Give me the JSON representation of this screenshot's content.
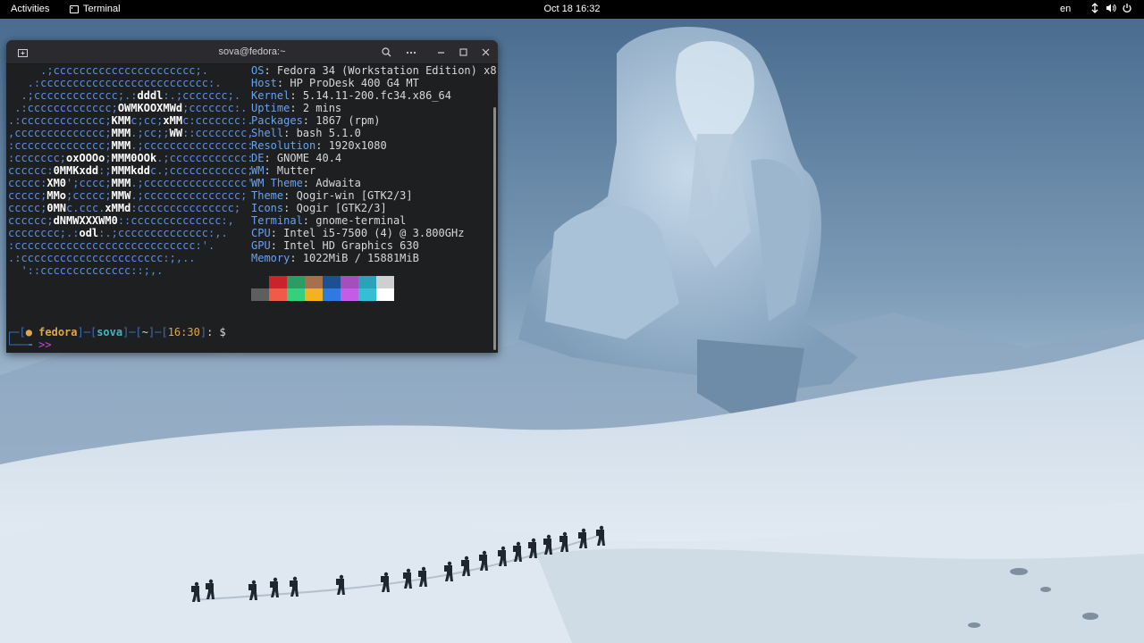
{
  "topbar": {
    "activities": "Activities",
    "app_name": "Terminal",
    "clock": "Oct 18  16:32",
    "language": "en"
  },
  "terminal": {
    "title": "sova@fedora:~",
    "logo_lines": [
      "     .;cccccccccccccccccccccc;.",
      "   .:cccccccccccccccccccccccccc:.",
      "  .;ccccccccccccc;.:dddl:.;ccccccc;.",
      " .:ccccccccccccc;OWMKOOXMWd;ccccccc:.",
      ".:ccccccccccccc;KMMc;cc;xMMc:ccccccc:.",
      ",cccccccccccccc;MMM.;cc;;WW::cccccccc,",
      ":cccccccccccccc;MMM.;cccccccccccccccc:",
      ":ccccccc;oxOOOo;MMM0OOk.;cccccccccccc:",
      "cccccc:0MMKxdd:;MMMkddc.;cccccccccccc;",
      "ccccc:XM0';cccc;MMM.;cccccccccccccccc'",
      "ccccc;MMo;ccccc;MMW.;ccccccccccccccc;",
      "ccccc;0MNc.ccc.xMMd:ccccccccccccccc;",
      "cccccc;dNMWXXXWM0::cccccccccccccc:,",
      "cccccccc;.:odl:.;cccccccccccccc:,.",
      ":cccccccccccccccccccccccccccc:'.",
      ".:cccccccccccccccccccccc:;,..",
      "  '::cccccccccccccc::;,."
    ],
    "sysinfo": [
      {
        "key": "OS",
        "value": "Fedora 34 (Workstation Edition) x8"
      },
      {
        "key": "Host",
        "value": "HP ProDesk 400 G4 MT"
      },
      {
        "key": "Kernel",
        "value": "5.14.11-200.fc34.x86_64"
      },
      {
        "key": "Uptime",
        "value": "2 mins"
      },
      {
        "key": "Packages",
        "value": "1867 (rpm)"
      },
      {
        "key": "Shell",
        "value": "bash 5.1.0"
      },
      {
        "key": "Resolution",
        "value": "1920x1080"
      },
      {
        "key": "DE",
        "value": "GNOME 40.4"
      },
      {
        "key": "WM",
        "value": "Mutter"
      },
      {
        "key": "WM Theme",
        "value": "Adwaita"
      },
      {
        "key": "Theme",
        "value": "Qogir-win [GTK2/3]"
      },
      {
        "key": "Icons",
        "value": "Qogir [GTK2/3]"
      },
      {
        "key": "Terminal",
        "value": "gnome-terminal"
      },
      {
        "key": "CPU",
        "value": "Intel i5-7500 (4) @ 3.800GHz"
      },
      {
        "key": "GPU",
        "value": "Intel HD Graphics 630"
      },
      {
        "key": "Memory",
        "value": "1022MiB / 15881MiB"
      }
    ],
    "palette": {
      "normal": [
        "#1d1f21",
        "#c9242c",
        "#2a9d62",
        "#a5704b",
        "#1c4f94",
        "#a44fbb",
        "#2aa3b8",
        "#cfcfcf"
      ],
      "bright": [
        "#5e5e5e",
        "#f05a48",
        "#34d07b",
        "#f2b31e",
        "#2f7ae0",
        "#c35de6",
        "#35bfd3",
        "#ffffff"
      ]
    },
    "prompt": {
      "host": "fedora",
      "user": "sova",
      "dir": "~",
      "time": "16:30",
      "symbol": "$",
      "input_marker": ">>"
    }
  }
}
